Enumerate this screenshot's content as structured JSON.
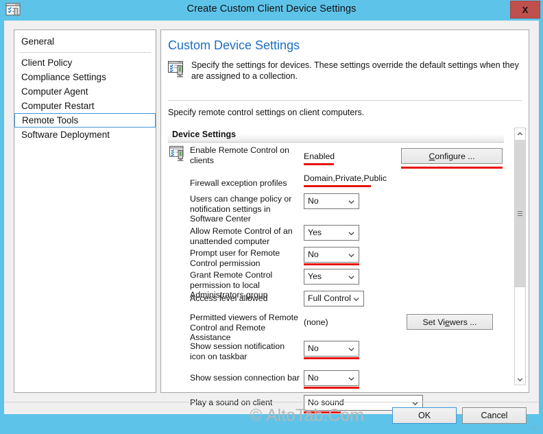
{
  "window": {
    "title": "Create Custom Client Device Settings",
    "icon": "settings-window-icon",
    "close_label": "X",
    "accent_color": "#5ec3e8",
    "annotation_color": "#e8120c"
  },
  "sidebar": {
    "items": [
      {
        "label": "General",
        "selected": false
      },
      {
        "label": "Client Policy",
        "selected": false
      },
      {
        "label": "Compliance Settings",
        "selected": false
      },
      {
        "label": "Computer Agent",
        "selected": false
      },
      {
        "label": "Computer Restart",
        "selected": false
      },
      {
        "label": "Remote Tools",
        "selected": true
      },
      {
        "label": "Software Deployment",
        "selected": false
      }
    ]
  },
  "main": {
    "heading": "Custom Device Settings",
    "description": "Specify the settings for devices. These settings override the default settings when they are assigned to a collection.",
    "sub_description": "Specify remote control settings on client computers.",
    "group_title": "Device Settings",
    "icon": "monitor-checklist-icon"
  },
  "settings": [
    {
      "label": "Enable Remote Control on clients",
      "control": "text",
      "value": "Enabled",
      "underlined": true,
      "has_icon": true,
      "button": {
        "label": "Configure ...",
        "accel": "C",
        "underlined": true
      }
    },
    {
      "label": "Firewall exception profiles",
      "control": "text",
      "value": "Domain,Private,Public",
      "underlined": true
    },
    {
      "label": "Users can change policy or notification settings in Software Center",
      "control": "combo",
      "value": "No",
      "underlined": false
    },
    {
      "label": "Allow Remote Control of an unattended computer",
      "control": "combo",
      "value": "Yes",
      "underlined": false
    },
    {
      "label": "Prompt user for Remote Control permission",
      "control": "combo",
      "value": "No",
      "underlined": true
    },
    {
      "label": "Grant Remote Control permission to local Administrators group",
      "control": "combo",
      "value": "Yes",
      "underlined": false
    },
    {
      "label": "Access level allowed",
      "control": "combo",
      "value": "Full Control",
      "underlined": false
    },
    {
      "label": "Permitted viewers of Remote Control and Remote Assistance",
      "control": "text",
      "value": "(none)",
      "underlined": false,
      "button": {
        "label": "Set Viewers ...",
        "accel": "e",
        "underlined": false
      }
    },
    {
      "label": "Show session notification icon on taskbar",
      "control": "combo",
      "value": "No",
      "underlined": true
    },
    {
      "label": "Show session connection bar",
      "control": "combo",
      "value": "No",
      "underlined": true
    },
    {
      "label": "Play a sound on client",
      "control": "combo",
      "value": "No sound",
      "underlined": true
    }
  ],
  "footer": {
    "ok_label": "OK",
    "cancel_label": "Cancel",
    "watermark": "© AltoTab.Com"
  }
}
